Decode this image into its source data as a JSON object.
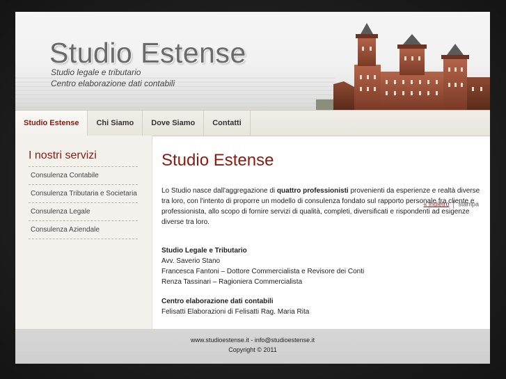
{
  "header": {
    "title": "Studio Estense",
    "subtitle_1": "Studio legale e tributario",
    "subtitle_2": "Centro elaborazione dati contabili"
  },
  "nav": {
    "tabs": [
      {
        "label": "Studio Estense",
        "active": true
      },
      {
        "label": "Chi Siamo",
        "active": false
      },
      {
        "label": "Dove Siamo",
        "active": false
      },
      {
        "label": "Contatti",
        "active": false
      }
    ]
  },
  "sidebar": {
    "heading": "I nostri servizi",
    "items": [
      {
        "label": "Consulenza Contabile"
      },
      {
        "label": "Consulenza Tributaria e Societaria"
      },
      {
        "label": "Consulenza Legale"
      },
      {
        "label": "Consulenza Aziendale"
      }
    ]
  },
  "main": {
    "title": "Studio Estense",
    "intro_before": "Lo Studio nasce dall'aggregazione di ",
    "intro_bold": "quattro professionisti",
    "intro_after": " provenienti da esperienze e realtà diverse tra loro, con l'intento di proporre un modello di consulenza fondato sul rapporto personale fra cliente e professionista, allo scopo di fornire servizi di qualità, completi, diversificati e rispondenti ad esigenze diverse tra loro.",
    "section1_title": "Studio Legale e Tributario",
    "section1_lines": [
      "Avv. Saverio Stano",
      "Francesca Fantoni – Dottore Commercialista e Revisore dei Conti",
      "Renza Tassinari – Ragioniera Commercialista"
    ],
    "section2_title": "Centro elaborazione dati contabili",
    "section2_lines": [
      "Felisatti Elaborazioni di  Felisatti Rag. Maria Rita"
    ],
    "back_link": "« indietro",
    "print_link": "stampa"
  },
  "footer": {
    "line1": "www.studioestense.it - info@studioestense.it",
    "line2": "Copyright © 2011"
  },
  "colors": {
    "accent": "#8b1a10",
    "nav_bg": "#ebe8e0",
    "sidebar_bg": "#f3f1ec",
    "footer_bg": "#d3d3d3"
  }
}
